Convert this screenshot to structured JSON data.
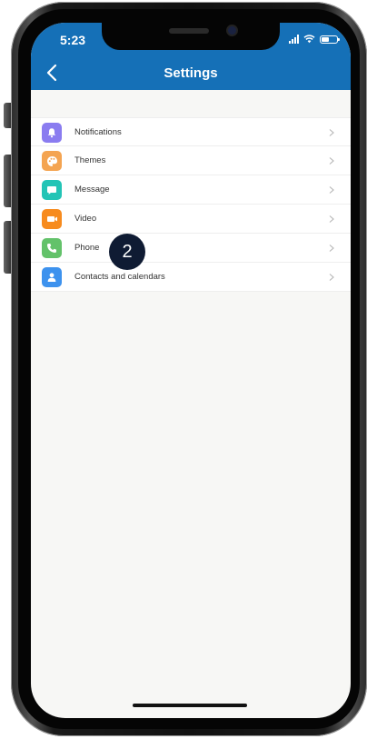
{
  "status_bar": {
    "time": "5:23"
  },
  "header": {
    "title": "Settings",
    "back_icon": "chevron-left-icon",
    "background_color": "#1570b7"
  },
  "settings_items": [
    {
      "label": "Notifications",
      "icon": "bell-icon",
      "color": "#8a7cf0"
    },
    {
      "label": "Themes",
      "icon": "palette-icon",
      "color": "#f4a451"
    },
    {
      "label": "Message",
      "icon": "message-icon",
      "color": "#23c4b6"
    },
    {
      "label": "Video",
      "icon": "video-camera-icon",
      "color": "#f78b1e"
    },
    {
      "label": "Phone",
      "icon": "phone-icon",
      "color": "#63c26a"
    },
    {
      "label": "Contacts and calendars",
      "icon": "contact-icon",
      "color": "#3d92ee"
    }
  ],
  "step_badge": {
    "number": "2",
    "color": "#0f1b33"
  }
}
